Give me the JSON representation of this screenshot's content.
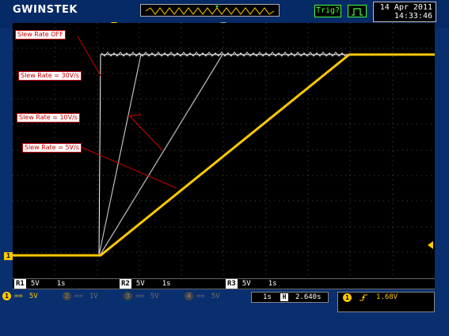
{
  "header": {
    "logo": "GWINSTEK",
    "trigger_status": "Trig?",
    "date": "14 Apr 2011",
    "time": "14:33:46"
  },
  "annotations": {
    "slew_off": "Slew Rate OFF",
    "slew_30": "Slew Rate = 30V/s",
    "slew_10": "Slew Rate = 10V/s",
    "slew_5": "Slew Rate = 5V/s"
  },
  "screen": {
    "ch1_marker": "1"
  },
  "reference_bar": {
    "refs": [
      {
        "label": "R1",
        "volts": "5V",
        "time": "1s"
      },
      {
        "label": "R2",
        "volts": "5V",
        "time": "1s"
      },
      {
        "label": "R3",
        "volts": "5V",
        "time": "1s"
      }
    ]
  },
  "channel_bar": {
    "channels": [
      {
        "num": "1",
        "coupling": "==",
        "volts": "5V",
        "color": "#ffc800",
        "active": true
      },
      {
        "num": "2",
        "coupling": "==",
        "volts": "1V",
        "color": "#555555",
        "active": false
      },
      {
        "num": "3",
        "coupling": "==",
        "volts": "5V",
        "color": "#555555",
        "active": false
      },
      {
        "num": "4",
        "coupling": "==",
        "volts": "5V",
        "color": "#555555",
        "active": false
      }
    ]
  },
  "horizontal": {
    "timebase": "1s",
    "position_icon": "H",
    "position": "2.640s"
  },
  "trigger": {
    "source": "1",
    "slope_icon": "rising-edge",
    "level": "1.68V"
  },
  "colors": {
    "ch1": "#ffc800",
    "reference": "#9a9a9a",
    "background": "#0a2f6e",
    "trigger_green": "#46ff46"
  }
}
